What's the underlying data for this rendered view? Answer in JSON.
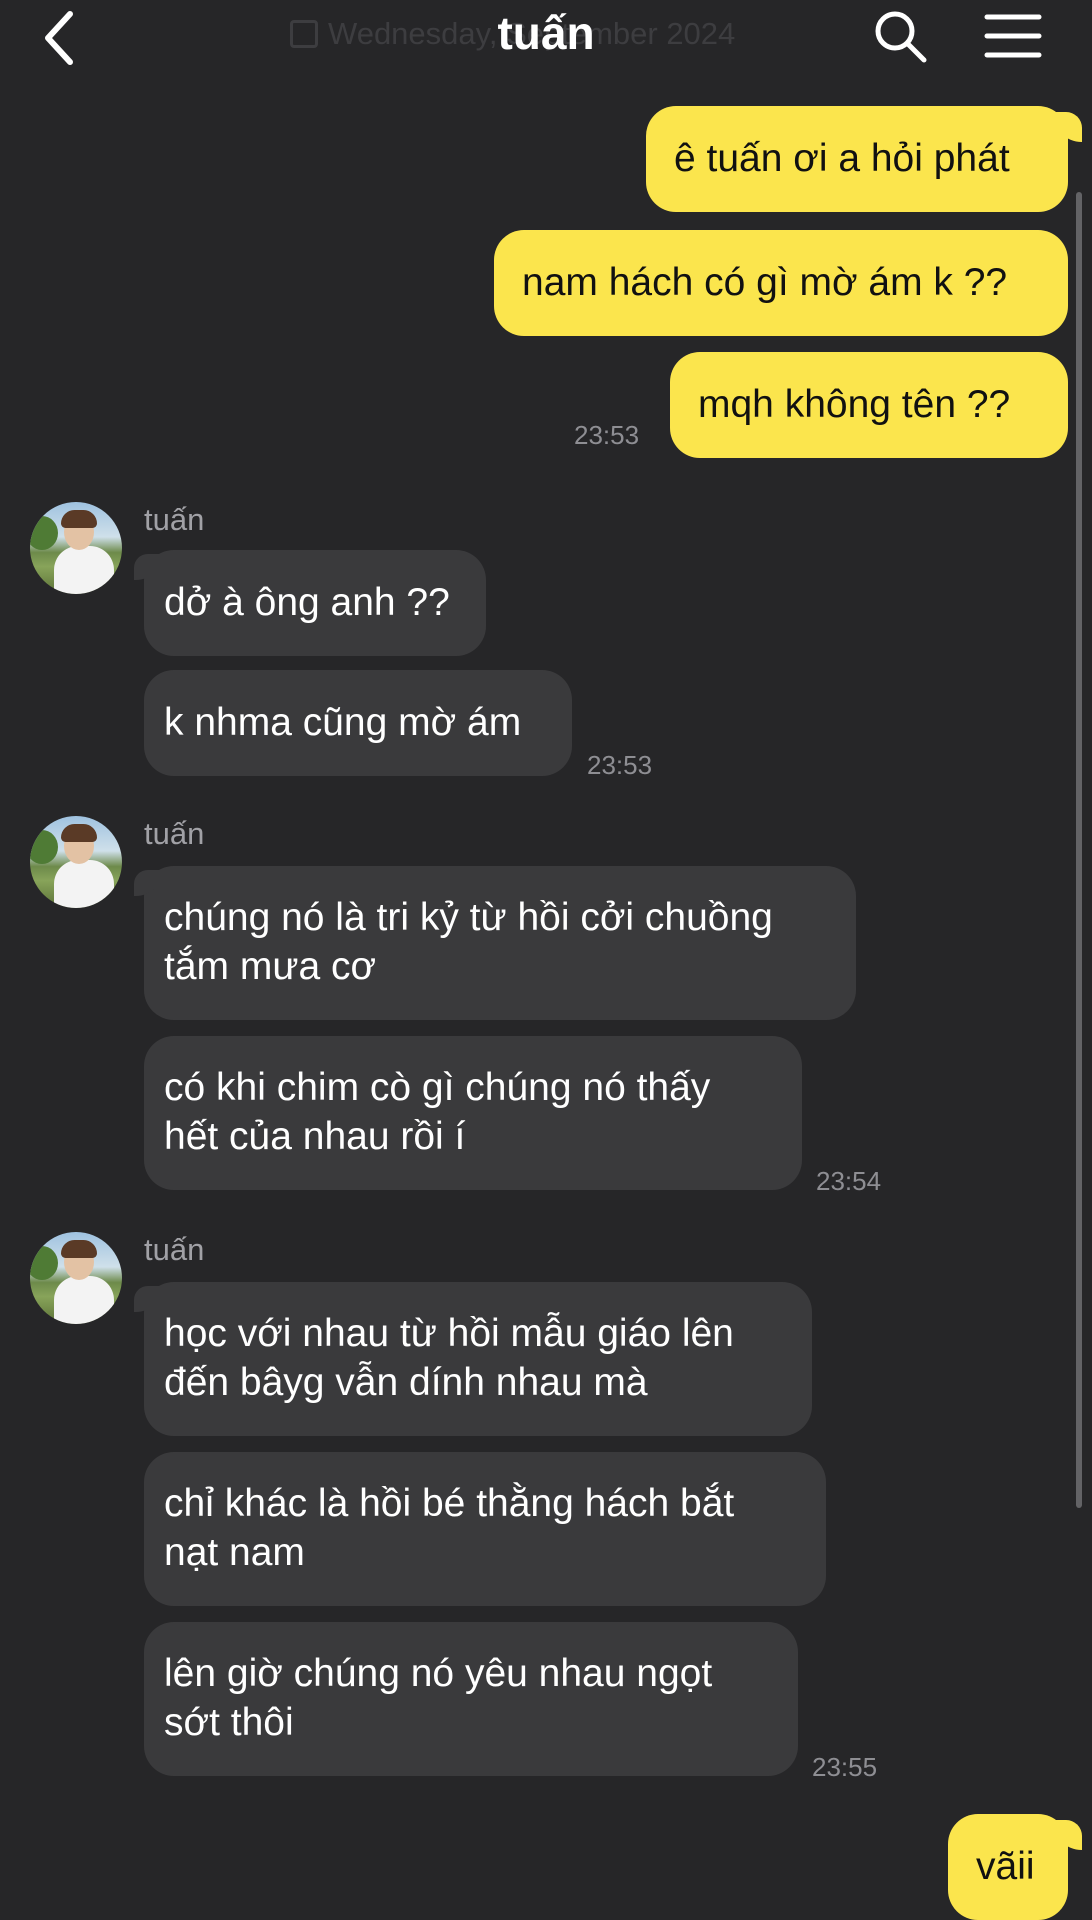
{
  "header": {
    "title": "tuấn",
    "date": "Wednesday, September 2024"
  },
  "messages": {
    "m1": "ê tuấn ơi a hỏi phát",
    "m2": "nam hách có gì mờ ám k ??",
    "m3": "mqh không tên ??",
    "t1": "23:53",
    "sender": "tuấn",
    "r1": "dở à ông anh ??",
    "r2": "k nhma cũng mờ ám",
    "t2": "23:53",
    "r3a": "chúng nó là tri kỷ từ hồi cởi chuồng",
    "r3b": "tắm mưa cơ",
    "r4a": "có khi chim cò gì chúng nó thấy",
    "r4b": "hết của nhau rồi í",
    "t3": "23:54",
    "r5a": "học với nhau từ hồi mẫu giáo lên",
    "r5b": "đến bâyg vẫn dính nhau mà",
    "r6a": "chỉ khác là hồi bé thằng hách bắt",
    "r6b": "nạt nam",
    "r7a": "lên giờ chúng nó yêu nhau ngọt",
    "r7b": "sớt thôi",
    "t4": "23:55",
    "m4": "vãii"
  }
}
